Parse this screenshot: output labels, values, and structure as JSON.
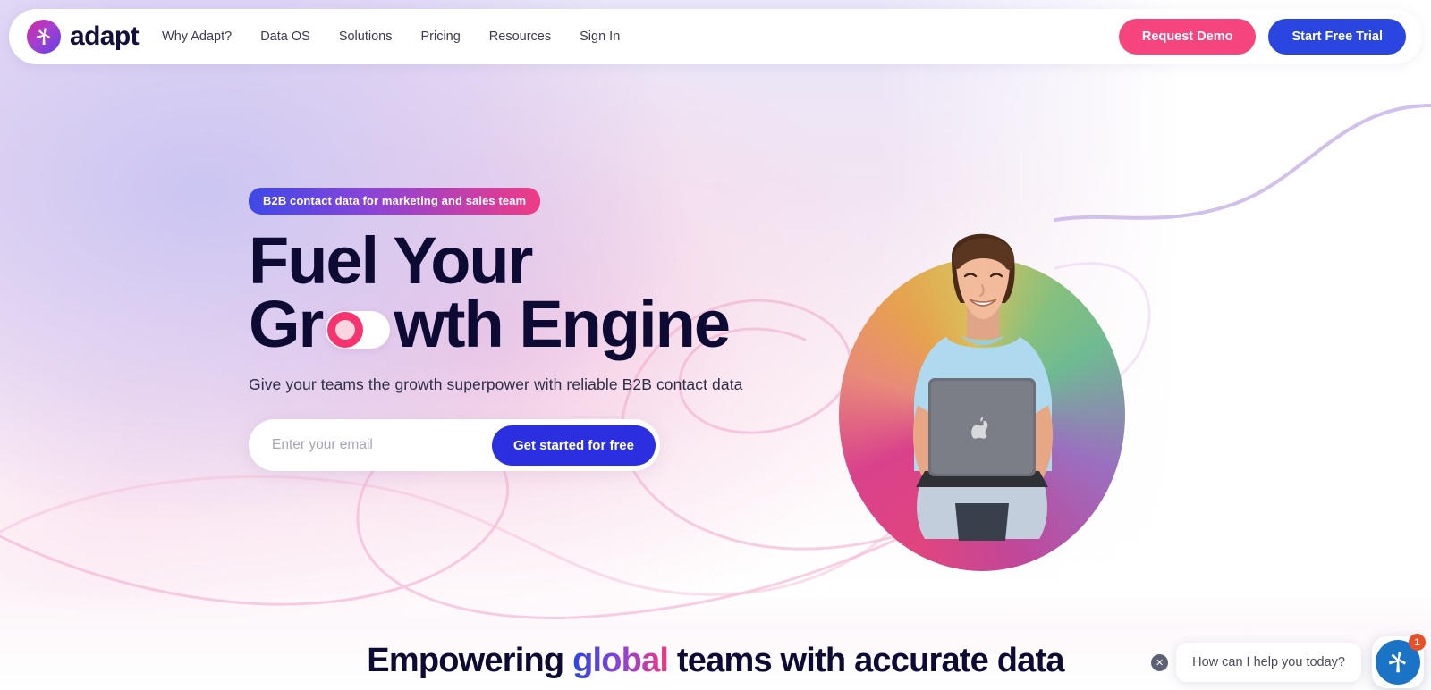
{
  "brand": {
    "name": "adapt",
    "mark_icon": "adapt-logo-icon"
  },
  "nav": {
    "items": [
      {
        "label": "Why Adapt?"
      },
      {
        "label": "Data OS"
      },
      {
        "label": "Solutions"
      },
      {
        "label": "Pricing"
      },
      {
        "label": "Resources"
      },
      {
        "label": "Sign In"
      }
    ]
  },
  "header_actions": {
    "demo_label": "Request Demo",
    "trial_label": "Start Free Trial",
    "demo_color": "#f6447e",
    "trial_color": "#2b45e0"
  },
  "hero": {
    "badge": "B2B contact data for marketing and sales team",
    "headline_line1": "Fuel Your",
    "headline_line2_pre": "Gr",
    "headline_line2_post": "wth Engine",
    "toggle_icon": "toggle-switch-icon",
    "subheadline": "Give your teams the growth superpower with reliable B2B contact data",
    "email_placeholder": "Enter your email",
    "email_value": "",
    "cta_label": "Get started for free",
    "image_alt": "person-with-laptop-illustration"
  },
  "section": {
    "heading_pre": "Empowering ",
    "heading_highlight": "global",
    "heading_post": " teams with accurate data"
  },
  "chat": {
    "close_icon": "close-icon",
    "message": "How can I help you today?",
    "launcher_icon": "adapt-chat-icon",
    "badge_count": "1"
  },
  "colors": {
    "accent_pink": "#f6447e",
    "accent_blue": "#2b45e0",
    "headline": "#0d0b33",
    "badge_gradient_start": "#3e49e8",
    "badge_gradient_end": "#ef3b86"
  }
}
